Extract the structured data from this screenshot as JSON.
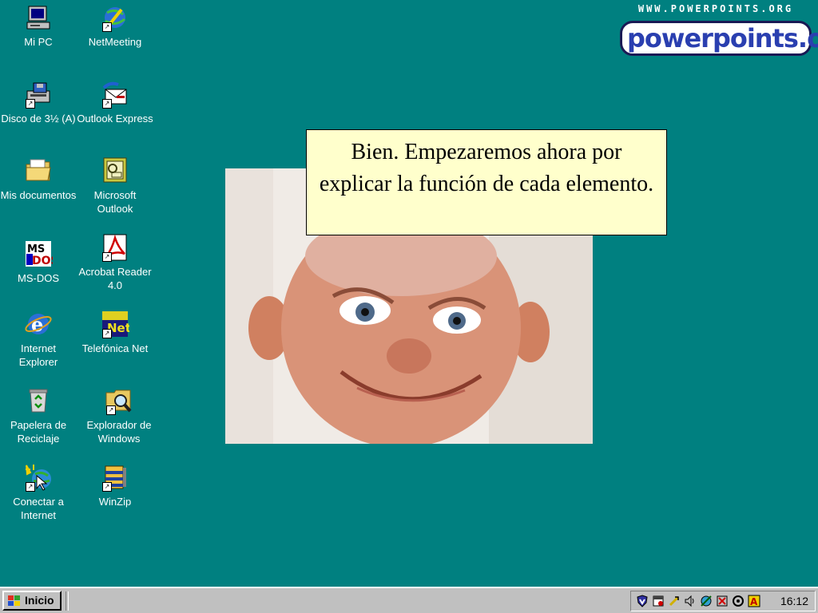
{
  "desktop": {
    "icons": [
      {
        "label": "Mi PC",
        "icon": "my-computer-icon"
      },
      {
        "label": "NetMeeting",
        "icon": "netmeeting-icon"
      },
      {
        "label": "Disco de 3½ (A)",
        "icon": "floppy-drive-icon"
      },
      {
        "label": "Outlook Express",
        "icon": "outlook-express-icon"
      },
      {
        "label": "Mis documentos",
        "icon": "folder-icon"
      },
      {
        "label": "Microsoft Outlook",
        "icon": "outlook-icon"
      },
      {
        "label": "MS-DOS",
        "icon": "ms-dos-icon"
      },
      {
        "label": "Acrobat Reader 4.0",
        "icon": "acrobat-icon"
      },
      {
        "label": "Internet Explorer",
        "icon": "internet-explorer-icon"
      },
      {
        "label": "Telefónica Net",
        "icon": "telefonica-net-icon"
      },
      {
        "label": "Papelera de Reciclaje",
        "icon": "recycle-bin-icon"
      },
      {
        "label": "Explorador de Windows",
        "icon": "explorer-icon"
      },
      {
        "label": "Conectar a Internet",
        "icon": "connect-internet-icon"
      },
      {
        "label": "WinZip",
        "icon": "winzip-icon"
      }
    ],
    "netlogo_text": "Net"
  },
  "logo": {
    "url": "WWW.POWERPOINTS.ORG",
    "brand": "powerpoints.org"
  },
  "callout": {
    "text": "Bien. Empezaremos ahora por explicar la función de cada elemento."
  },
  "taskbar": {
    "start_label": "Inicio",
    "clock": "16:12"
  },
  "colors": {
    "desktop": "#008080",
    "taskbar": "#c0c0c0",
    "callout": "#ffffcc"
  }
}
